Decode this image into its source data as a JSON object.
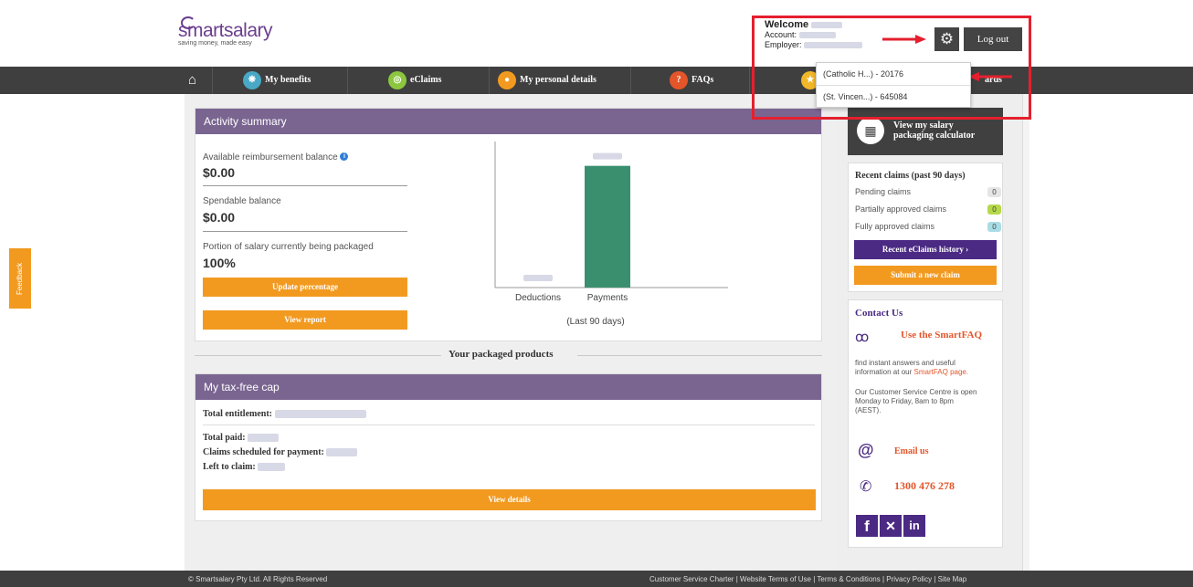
{
  "header": {
    "logo_text": "smartsalary",
    "logo_tagline": "saving money, made easy",
    "welcome": "Welcome",
    "account_label": "Account:",
    "employer_label": "Employer:",
    "logout_label": "Log out"
  },
  "employer_dropdown": {
    "options": [
      "(Catholic H...) - 20176",
      "(St. Vincen...) - 645084"
    ]
  },
  "nav": {
    "items": [
      {
        "label": "My benefits",
        "icon": "benefits-icon",
        "color": "#49a9c4"
      },
      {
        "label": "eClaims",
        "icon": "eclaims-icon",
        "color": "#8cc63e"
      },
      {
        "label": "My personal details",
        "icon": "person-icon",
        "color": "#f29a20"
      },
      {
        "label": "FAQs",
        "icon": "question-icon",
        "color": "#e4552a"
      },
      {
        "label": "ards",
        "icon": "rewards-icon",
        "color": "#f2b629"
      }
    ]
  },
  "feedback_label": "Feedback",
  "activity": {
    "title": "Activity summary",
    "reimbursement_label": "Available reimbursement balance",
    "reimbursement_value": "$0.00",
    "spendable_label": "Spendable balance",
    "spendable_value": "$0.00",
    "portion_label": "Portion of salary currently being packaged",
    "portion_value": "100%",
    "update_button": "Update percentage",
    "report_button": "View report",
    "chart_caption": "(Last 90 days)"
  },
  "chart_data": {
    "type": "bar",
    "categories": [
      "Deductions",
      "Payments"
    ],
    "values": [
      0,
      100
    ],
    "ylim": [
      0,
      120
    ],
    "colors": [
      "#3a8f6f",
      "#3a8f6f"
    ]
  },
  "products_divider": "Your packaged products",
  "tax_cap": {
    "title": "My tax-free cap",
    "entitlement_label": "Total entitlement:",
    "paid_label": "Total paid:",
    "scheduled_label": "Claims scheduled for payment:",
    "left_label": "Left to claim:",
    "details_button": "View details"
  },
  "sidebar": {
    "calc_line1": "View my salary",
    "calc_line2": "packaging calculator",
    "recent_title": "Recent claims (past 90 days)",
    "pending_label": "Pending claims",
    "pending_count": "0",
    "partial_label": "Partially approved claims",
    "partial_count": "0",
    "full_label": "Fully approved claims",
    "full_count": "0",
    "history_button": "Recent eClaims history",
    "submit_button": "Submit a new claim",
    "contact_title": "Contact Us",
    "faq_link": "Use the SmartFAQ",
    "faq_text1": "find instant answers and useful",
    "faq_text2": "information at our",
    "faq_page_link": "SmartFAQ page.",
    "service_text1": "Our Customer Service Centre is open",
    "service_text2": "Monday to Friday, 8am to 8pm",
    "service_text3": "(AEST).",
    "email_link": "Email us",
    "phone": "1300 476 278"
  },
  "footer": {
    "copyright": "© Smartsalary Pty Ltd. All Rights Reserved",
    "links": [
      "Customer Service Charter",
      "Website Terms of Use",
      "Terms & Conditions",
      "Privacy Policy",
      "Site Map"
    ]
  },
  "colors": {
    "nav_bg": "#3f3f3f",
    "panel_head": "#7a6591",
    "orange": "#f29a20",
    "purple_btn": "#4b2a83",
    "bar_green": "#3a8f6f"
  }
}
